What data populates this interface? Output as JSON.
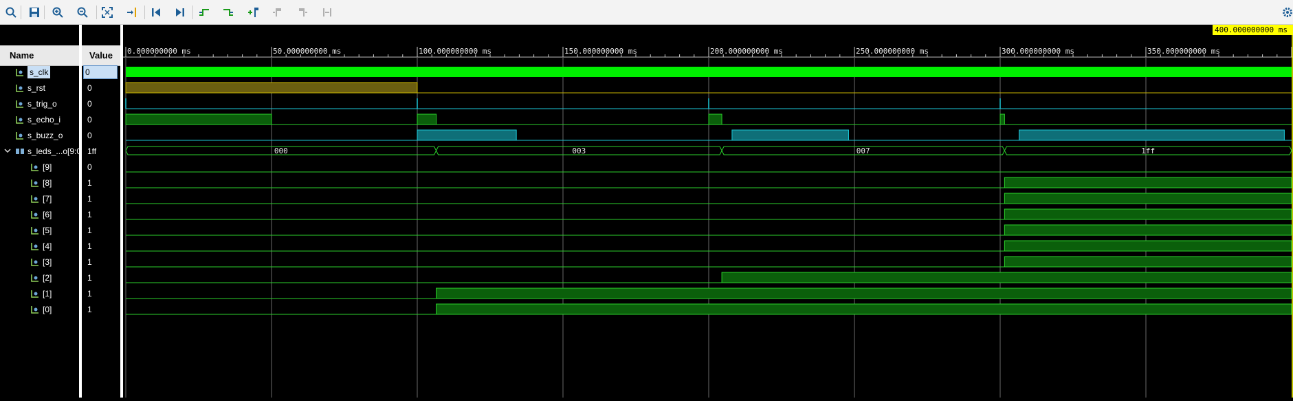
{
  "toolbar": {
    "buttons": [
      {
        "icon": "search-icon"
      },
      {
        "icon": "save-icon"
      },
      {
        "icon": "zoom-in-icon"
      },
      {
        "icon": "zoom-out-icon"
      },
      {
        "icon": "zoom-fit-icon"
      },
      {
        "icon": "go-to-cursor-icon"
      },
      {
        "icon": "go-to-start-icon"
      },
      {
        "icon": "go-to-end-icon"
      },
      {
        "icon": "previous-transition-icon"
      },
      {
        "icon": "next-transition-icon"
      },
      {
        "icon": "add-marker-icon"
      },
      {
        "icon": "previous-marker-icon"
      },
      {
        "icon": "next-marker-icon"
      },
      {
        "icon": "swap-cursors-icon"
      }
    ]
  },
  "headers": {
    "name": "Name",
    "value": "Value"
  },
  "signals": [
    {
      "name": "s_clk",
      "value": "0",
      "selected": true
    },
    {
      "name": "s_rst",
      "value": "0"
    },
    {
      "name": "s_trig_o",
      "value": "0"
    },
    {
      "name": "s_echo_i",
      "value": "0"
    },
    {
      "name": "s_buzz_o",
      "value": "0"
    },
    {
      "name": "s_leds_...o[9:0",
      "value": "1ff",
      "bus": true
    },
    {
      "name": "[9]",
      "value": "0"
    },
    {
      "name": "[8]",
      "value": "1"
    },
    {
      "name": "[7]",
      "value": "1"
    },
    {
      "name": "[6]",
      "value": "1"
    },
    {
      "name": "[5]",
      "value": "1"
    },
    {
      "name": "[4]",
      "value": "1"
    },
    {
      "name": "[3]",
      "value": "1"
    },
    {
      "name": "[2]",
      "value": "1"
    },
    {
      "name": "[1]",
      "value": "1"
    },
    {
      "name": "[0]",
      "value": "1"
    }
  ],
  "timeline": {
    "ticks": [
      "0.000000000 ms",
      "50.000000000 ms",
      "100.000000000 ms",
      "150.000000000 ms",
      "200.000000000 ms",
      "250.000000000 ms",
      "300.000000000 ms",
      "350.000000000 ms"
    ],
    "cursor_label": "400.000000000 ms"
  },
  "bus_values": [
    "000",
    "003",
    "007",
    "1ff"
  ],
  "colors": {
    "clock": "#00ee00",
    "reset": "#c7b400",
    "signal": "#2bd12b",
    "cyan": "#1cc8d8",
    "cyan_fill": "#0f6f78",
    "green_fill": "#0b5f0b",
    "marker": "#ffff00"
  }
}
